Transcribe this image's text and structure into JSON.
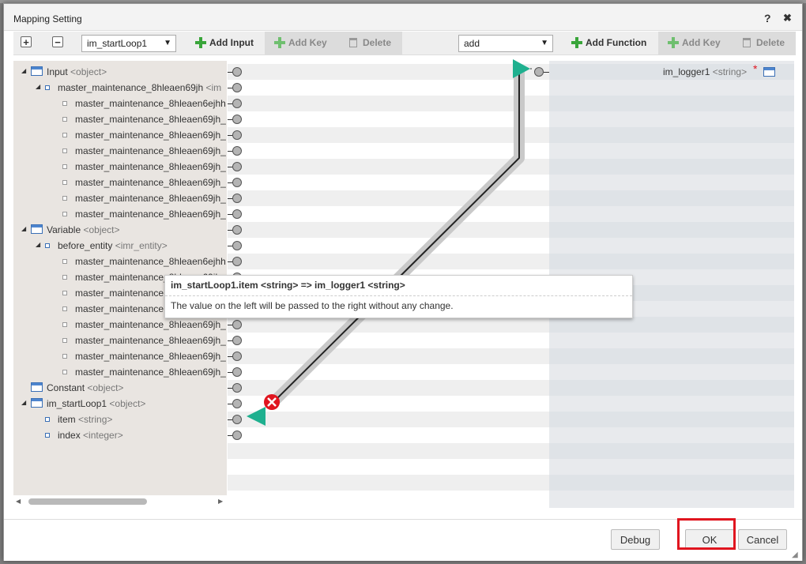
{
  "dialog": {
    "title": "Mapping Setting",
    "help_label": "?",
    "close_label": "✖"
  },
  "toolbar": {
    "expand_label": "+",
    "collapse_label": "−",
    "source_select": "im_startLoop1",
    "add_input_label": "Add Input",
    "add_key_left_label": "Add Key",
    "delete_left_label": "Delete",
    "function_select": "add",
    "add_function_label": "Add Function",
    "add_key_right_label": "Add Key",
    "delete_right_label": "Delete"
  },
  "tree": {
    "input": {
      "name": "Input",
      "type": "<object>"
    },
    "input_child": {
      "name": "master_maintenance_8hleaen69jh",
      "type": "<im"
    },
    "input_leaves": [
      "master_maintenance_8hleaen6ejhh",
      "master_maintenance_8hleaen69jh_",
      "master_maintenance_8hleaen69jh_",
      "master_maintenance_8hleaen69jh_",
      "master_maintenance_8hleaen69jh_",
      "master_maintenance_8hleaen69jh_",
      "master_maintenance_8hleaen69jh_",
      "master_maintenance_8hleaen69jh_"
    ],
    "variable": {
      "name": "Variable",
      "type": "<object>"
    },
    "variable_child": {
      "name": "before_entity",
      "type": "<imr_entity>"
    },
    "variable_leaves": [
      "master_maintenance_8hleaen6ejhh",
      "master_maintenance_8hleaen69jh",
      "master_maintenance",
      "master_maintenance",
      "master_maintenance_8hleaen69jh_",
      "master_maintenance_8hleaen69jh_",
      "master_maintenance_8hleaen69jh_",
      "master_maintenance_8hleaen69jh_"
    ],
    "constant": {
      "name": "Constant",
      "type": "<object>"
    },
    "loop": {
      "name": "im_startLoop1",
      "type": "<object>"
    },
    "loop_children": [
      {
        "name": "item",
        "type": "<string>"
      },
      {
        "name": "index",
        "type": "<integer>"
      }
    ]
  },
  "target": {
    "name": "im_logger1",
    "type": "<string>",
    "required_mark": "*"
  },
  "tooltip": {
    "title": "im_startLoop1.item <string> => im_logger1 <string>",
    "body": "The value on the left will be passed to the right without any change."
  },
  "footer": {
    "debug_label": "Debug",
    "ok_label": "OK",
    "cancel_label": "Cancel"
  },
  "colors": {
    "accent_green": "#1fb08f",
    "delete_red": "#e0151f",
    "highlight": "#e0151f"
  }
}
